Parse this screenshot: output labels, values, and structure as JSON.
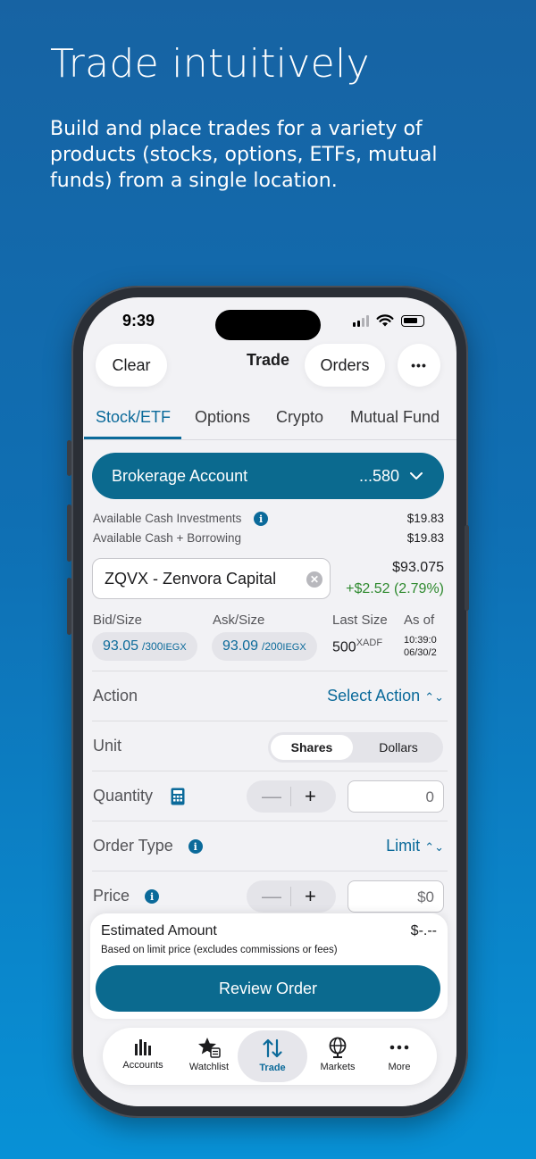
{
  "promo": {
    "title": "Trade intuitively",
    "subtitle": "Build and place trades for a variety of products (stocks, options, ETFs, mutual funds) from a single location."
  },
  "status_bar": {
    "time": "9:39"
  },
  "header": {
    "clear_label": "Clear",
    "title": "Trade",
    "orders_label": "Orders",
    "more_label": "•••"
  },
  "tabs": [
    "Stock/ETF",
    "Options",
    "Crypto",
    "Mutual Fund"
  ],
  "account": {
    "label": "Brokerage Account",
    "number": "...580"
  },
  "cash": {
    "investments_label": "Available Cash Investments",
    "investments_value": "$19.83",
    "borrowing_label": "Available Cash + Borrowing",
    "borrowing_value": "$19.83"
  },
  "symbol": {
    "value": "ZQVX - Zenvora Capital",
    "price": "$93.075",
    "change": "+$2.52 (2.79%)"
  },
  "quote": {
    "bid_label": "Bid/Size",
    "bid_price": "93.05",
    "bid_size": "/300",
    "bid_exch": "IEGX",
    "ask_label": "Ask/Size",
    "ask_price": "93.09",
    "ask_size": "/200",
    "ask_exch": "IEGX",
    "last_size_label": "Last Size",
    "last_size": "500",
    "last_exch": "XADF",
    "asof_label": "As of",
    "asof_time": "10:39:0",
    "asof_date": "06/30/2"
  },
  "form": {
    "action_label": "Action",
    "action_value": "Select Action",
    "unit_label": "Unit",
    "unit_selected": "Shares",
    "unit_other": "Dollars",
    "quantity_label": "Quantity",
    "quantity_value": "0",
    "order_type_label": "Order Type",
    "order_type_value": "Limit",
    "price_label": "Price",
    "price_value": "$0"
  },
  "estimate": {
    "title": "Estimated Amount",
    "value": "$-.--",
    "note": "Based on limit price (excludes commissions or fees)",
    "review_label": "Review Order"
  },
  "tabbar": [
    {
      "label": "Accounts",
      "icon": "accounts-bars-icon"
    },
    {
      "label": "Watchlist",
      "icon": "watchlist-star-icon"
    },
    {
      "label": "Trade",
      "icon": "trade-arrows-icon"
    },
    {
      "label": "Markets",
      "icon": "markets-globe-icon"
    },
    {
      "label": "More",
      "icon": "more-dots-icon"
    }
  ],
  "colors": {
    "accent": "#0b6a9a",
    "button": "#0b6a8f",
    "positive": "#2f8a2f"
  }
}
